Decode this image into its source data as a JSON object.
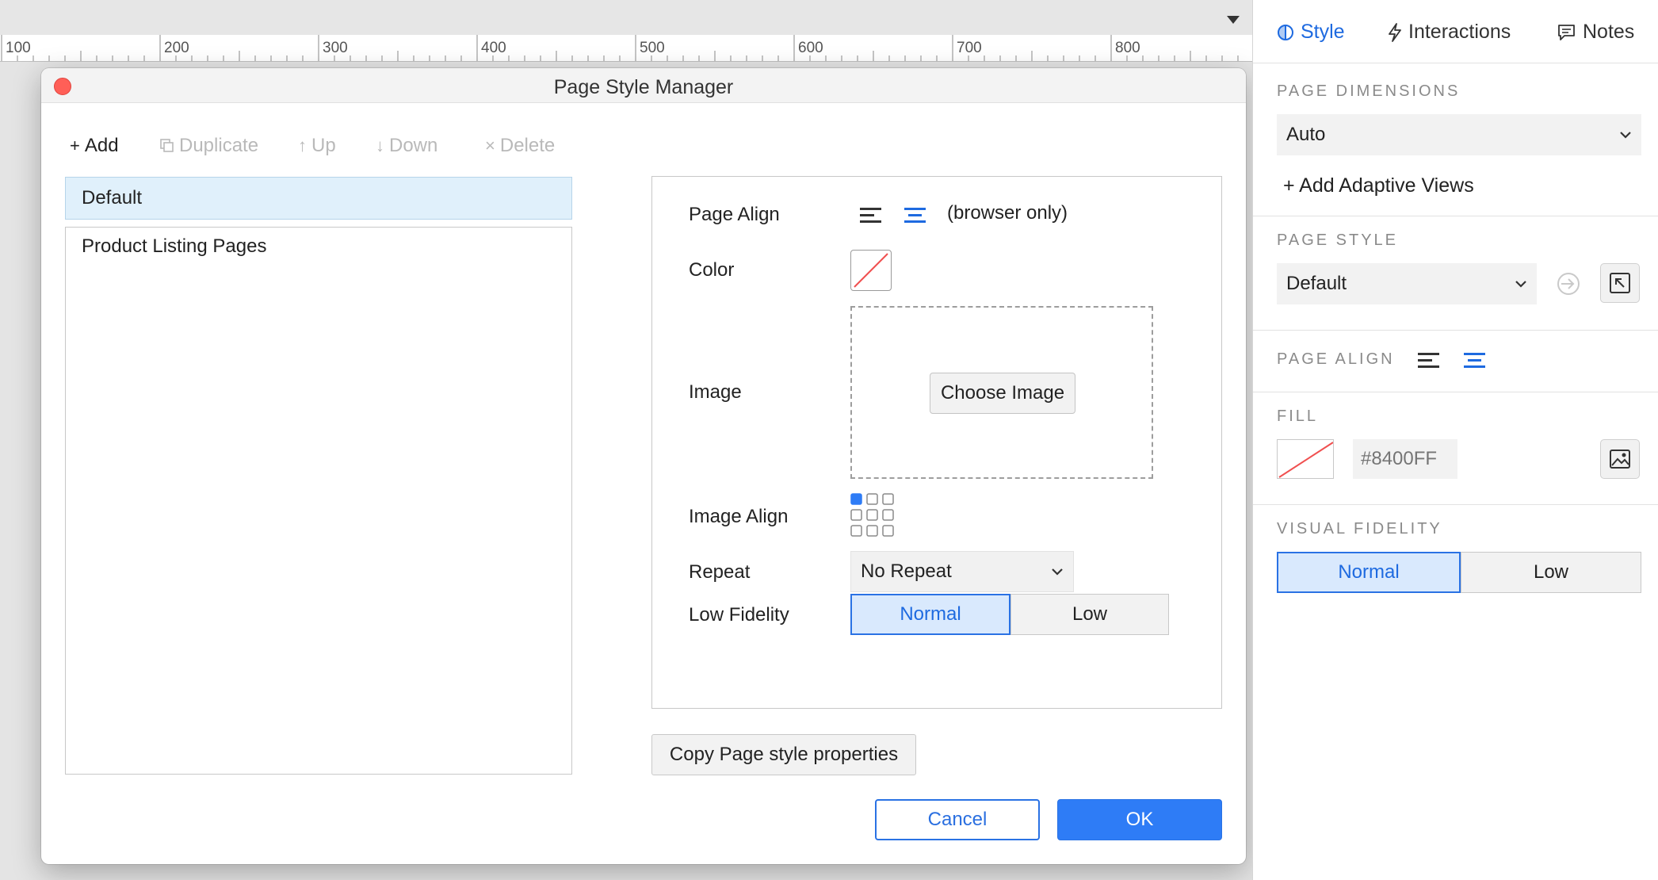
{
  "ruler": {
    "labels": [
      "100",
      "200",
      "300",
      "400",
      "500",
      "600",
      "700",
      "800"
    ]
  },
  "dialog": {
    "title": "Page Style Manager",
    "toolbar": {
      "add": "Add",
      "duplicate": "Duplicate",
      "up": "Up",
      "down": "Down",
      "delete": "Delete"
    },
    "styles_list": {
      "selected": "Default",
      "items": [
        "Product Listing Pages"
      ]
    },
    "properties": {
      "page_align_label": "Page Align",
      "browser_only": "(browser only)",
      "color_label": "Color",
      "image_label": "Image",
      "choose_image": "Choose Image",
      "image_align_label": "Image Align",
      "repeat_label": "Repeat",
      "repeat_value": "No Repeat",
      "low_fidelity_label": "Low Fidelity",
      "fidelity_normal": "Normal",
      "fidelity_low": "Low"
    },
    "copy_button": "Copy Page style properties",
    "cancel": "Cancel",
    "ok": "OK"
  },
  "inspector": {
    "tabs": {
      "style": "Style",
      "interactions": "Interactions",
      "notes": "Notes"
    },
    "page_dimensions": {
      "title": "PAGE DIMENSIONS",
      "value": "Auto",
      "add_adaptive": "Add Adaptive Views"
    },
    "page_style": {
      "title": "PAGE STYLE",
      "value": "Default"
    },
    "page_align": {
      "title": "PAGE ALIGN"
    },
    "fill": {
      "title": "FILL",
      "hex_placeholder": "#8400FF"
    },
    "visual_fidelity": {
      "title": "VISUAL FIDELITY",
      "normal": "Normal",
      "low": "Low"
    }
  },
  "colors": {
    "accent": "#2E7CF6",
    "selection_bg": "#E0F0FB",
    "close_button": "#FF5F57",
    "no_fill_line": "#F05050"
  }
}
